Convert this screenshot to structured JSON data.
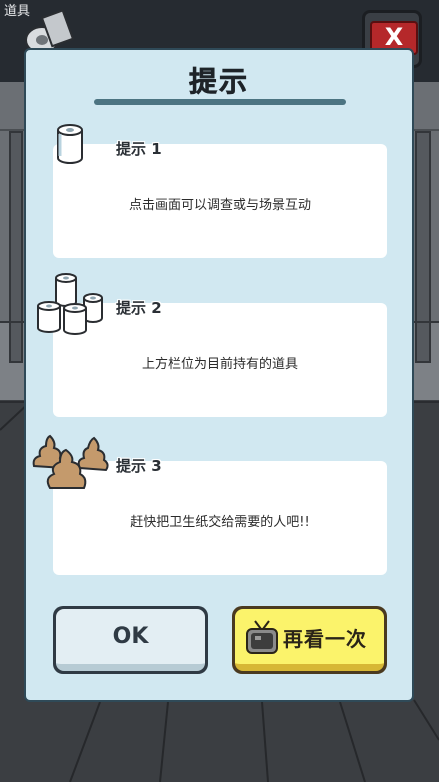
{
  "topbar": {
    "label": "道具",
    "item_icon": "toilet-paper-roll-icon",
    "close_label": "X"
  },
  "dialog": {
    "title": "提示",
    "hints": [
      {
        "label": "提示 1",
        "text": "点击画面可以调查或与场景互动",
        "icon": "single-paper-roll-icon"
      },
      {
        "label": "提示 2",
        "text": "上方栏位为目前持有的道具",
        "icon": "stacked-paper-rolls-icon"
      },
      {
        "label": "提示 3",
        "text": "赶快把卫生纸交给需要的人吧!!",
        "icon": "poop-pile-icon"
      }
    ],
    "ok_label": "OK",
    "again_label": "再看一次",
    "again_icon": "tv-icon"
  },
  "colors": {
    "dialog_bg": "#d1e8f1",
    "ok_face": "#e3eef3",
    "again_face": "#fbf36b",
    "close_red": "#b5282a"
  }
}
